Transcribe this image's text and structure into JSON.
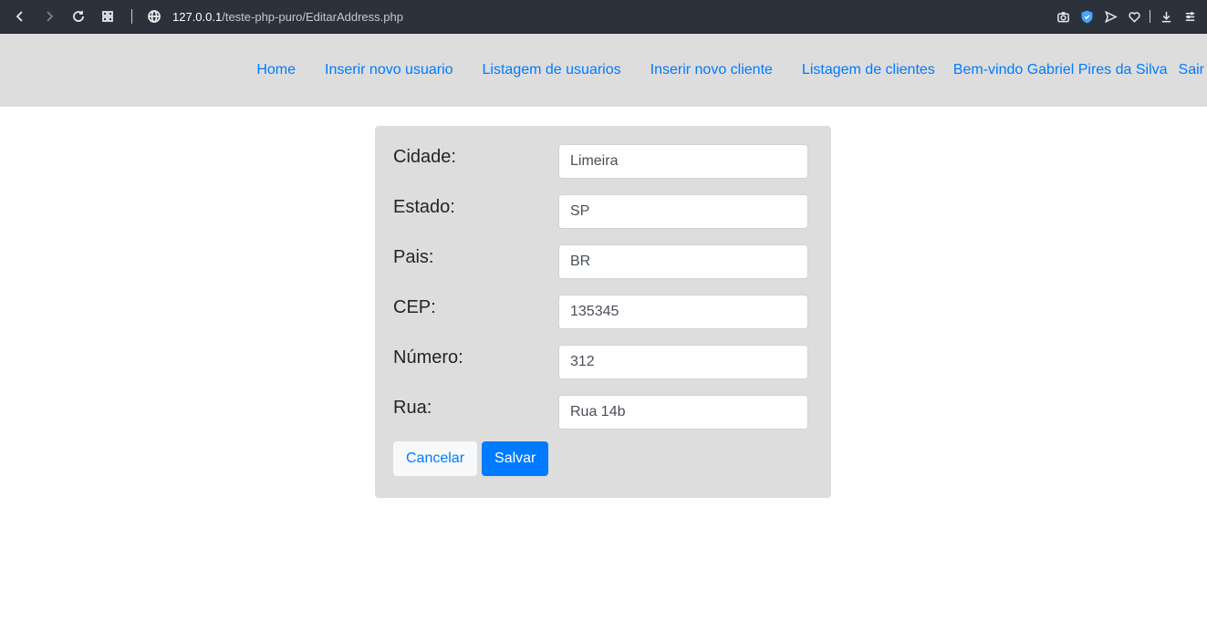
{
  "browser": {
    "url_host": "127.0.0.1",
    "url_path": "/teste-php-puro/EditarAddress.php"
  },
  "nav": {
    "items": [
      "Home",
      "Inserir novo usuario",
      "Listagem de usuarios",
      "Inserir novo cliente",
      "Listagem de clientes"
    ],
    "welcome": "Bem-vindo Gabriel Pires da Silva",
    "logout": "Sair",
    "link_color": "#007bff"
  },
  "form": {
    "fields": [
      {
        "label": "Cidade:",
        "value": "Limeira"
      },
      {
        "label": "Estado:",
        "value": "SP"
      },
      {
        "label": "Pais:",
        "value": "BR"
      },
      {
        "label": "CEP:",
        "value": "135345"
      },
      {
        "label": "Número:",
        "value": "312"
      },
      {
        "label": "Rua:",
        "value": "Rua 14b"
      }
    ],
    "cancel_label": "Cancelar",
    "save_label": "Salvar"
  }
}
